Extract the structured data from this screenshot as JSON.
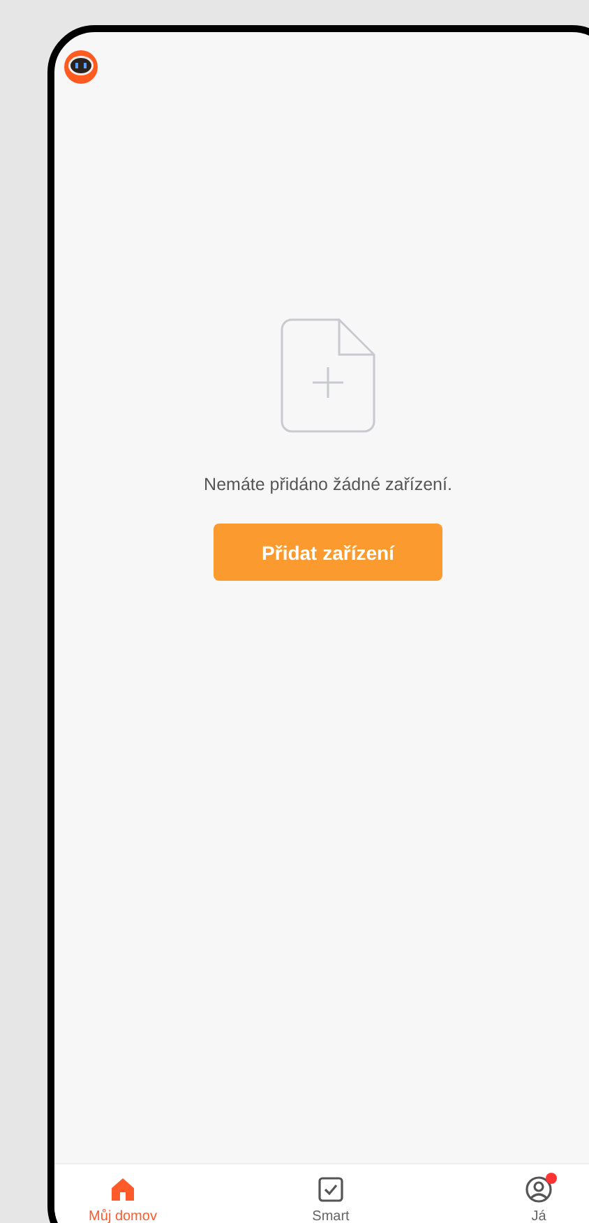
{
  "empty_state": {
    "message": "Nemáte přidáno žádné zařízení.",
    "button": "Přidat zařízení"
  },
  "tab_bar": [
    {
      "kind": "home",
      "label": "Můj domov",
      "selected": true,
      "badge": false
    },
    {
      "kind": "smart",
      "label": "Smart",
      "selected": false,
      "badge": false
    },
    {
      "kind": "profile",
      "label": "Já",
      "selected": false,
      "badge": true
    }
  ]
}
